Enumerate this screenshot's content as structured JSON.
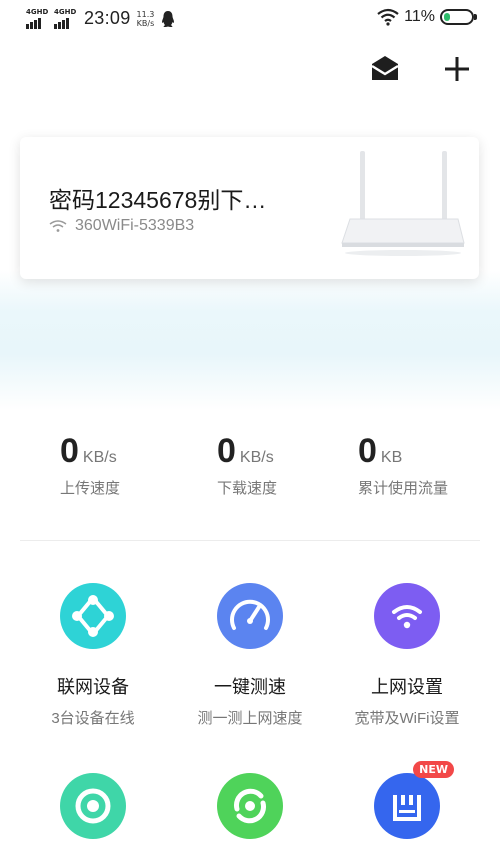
{
  "status_bar": {
    "signal1_label": "4GHD",
    "signal2_label": "4GHD",
    "time": "23:09",
    "net_speed_value": "11.3",
    "net_speed_unit": "KB/s",
    "battery_pct": "11%"
  },
  "header": {
    "mail_icon": "mail-icon",
    "add_icon": "plus-icon"
  },
  "device_card": {
    "name": "密码12345678别下…",
    "ssid": "360WiFi-5339B3",
    "wifi_icon": "wifi-icon",
    "image": "router-image"
  },
  "stats": [
    {
      "value": "0",
      "unit": "KB/s",
      "label": "上传速度"
    },
    {
      "value": "0",
      "unit": "KB/s",
      "label": "下载速度"
    },
    {
      "value": "0",
      "unit": "KB",
      "label": "累计使用流量"
    }
  ],
  "features": [
    {
      "title": "联网设备",
      "subtitle": "3台设备在线",
      "icon": "connected-devices-icon",
      "color": "#2ed3d6"
    },
    {
      "title": "一键测速",
      "subtitle": "测一测上网速度",
      "icon": "speedometer-icon",
      "color": "#5b84f0"
    },
    {
      "title": "上网设置",
      "subtitle": "宽带及WiFi设置",
      "icon": "wifi-settings-icon",
      "color": "#7d5df2"
    },
    {
      "title": "",
      "subtitle": "",
      "icon": "ring-icon",
      "color": "#3fd6a8"
    },
    {
      "title": "",
      "subtitle": "",
      "icon": "refresh-ring-icon",
      "color": "#4fd35a"
    },
    {
      "title": "",
      "subtitle": "",
      "icon": "storage-icon",
      "color": "#3566ee",
      "badge": "NEW"
    }
  ]
}
